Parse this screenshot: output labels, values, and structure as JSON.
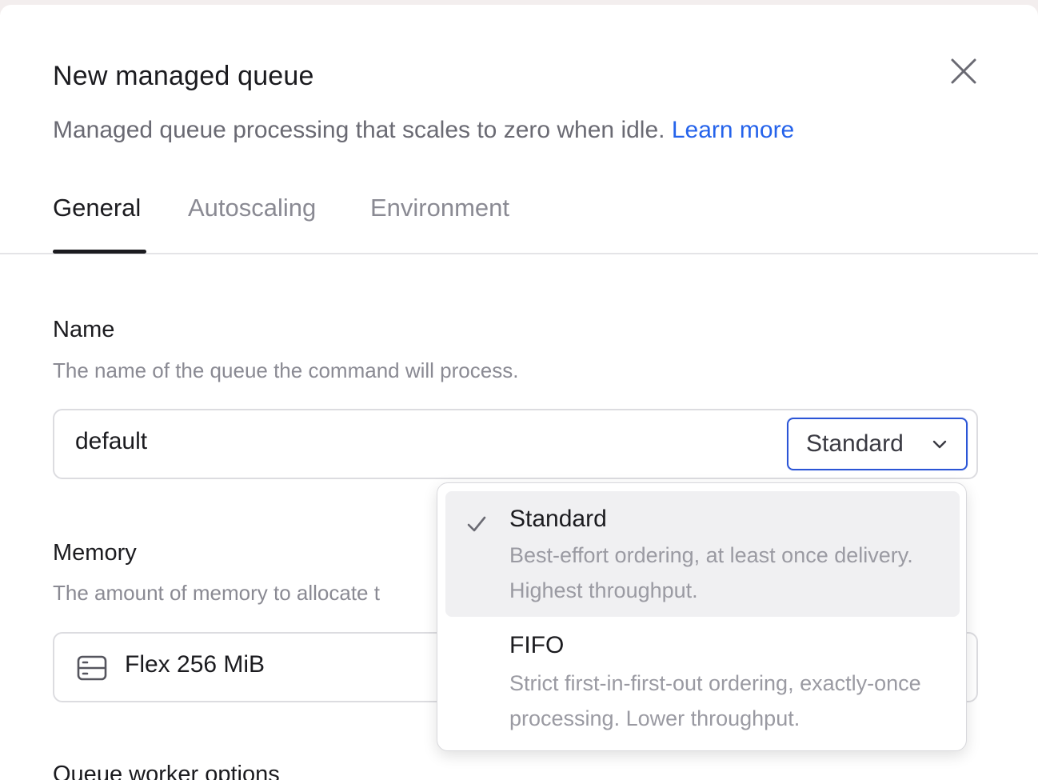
{
  "dialog": {
    "title": "New managed queue",
    "subtitle": "Managed queue processing that scales to zero when idle.",
    "learn_more": "Learn more"
  },
  "tabs": [
    {
      "label": "General",
      "active": true
    },
    {
      "label": "Autoscaling",
      "active": false
    },
    {
      "label": "Environment",
      "active": false
    }
  ],
  "name_field": {
    "label": "Name",
    "help": "The name of the queue the command will process.",
    "value": "default",
    "type_selected": "Standard"
  },
  "memory_field": {
    "label": "Memory",
    "help": "The amount of memory to allocate t",
    "value": "Flex 256 MiB"
  },
  "queue_type_options": [
    {
      "title": "Standard",
      "description": "Best-effort ordering, at least once delivery. Highest throughput.",
      "selected": true
    },
    {
      "title": "FIFO",
      "description": "Strict first-in-first-out ordering, exactly-once processing. Lower throughput.",
      "selected": false
    }
  ],
  "next_section": {
    "label": "Queue worker options"
  },
  "icons": {
    "close": "close-icon",
    "chevron": "chevron-down-icon",
    "check": "check-icon",
    "memory": "server-icon"
  },
  "colors": {
    "accent": "#2563eb",
    "select_border": "#2b55d6",
    "text": "#1b1b1f",
    "muted": "#8a8a93"
  }
}
